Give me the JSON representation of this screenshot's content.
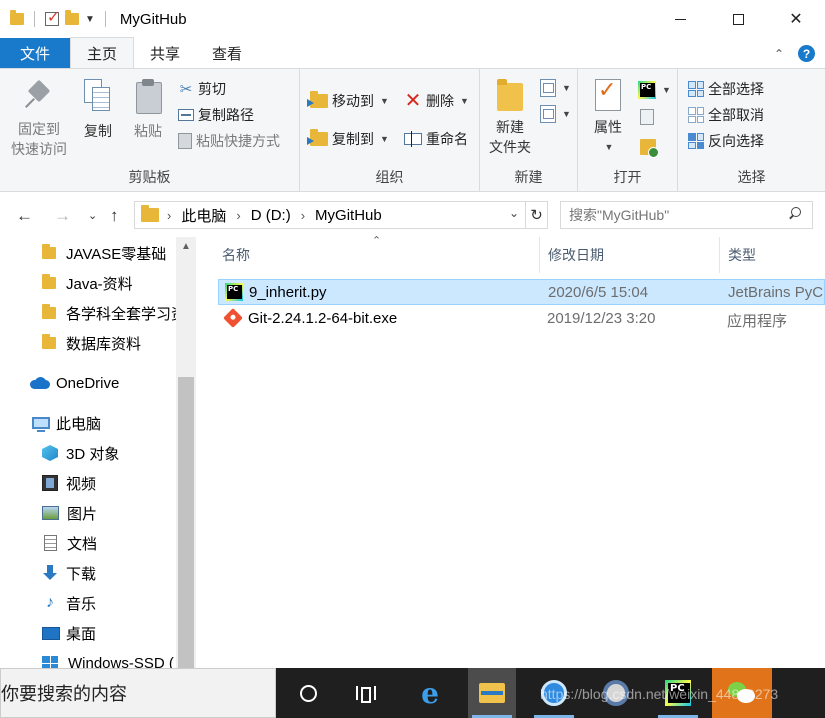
{
  "window": {
    "title": "MyGitHub",
    "controls": {
      "minimize": "—",
      "maximize": "☐",
      "close": "✕"
    }
  },
  "tabs": {
    "file": "文件",
    "items": [
      "主页",
      "共享",
      "查看"
    ],
    "active": "主页"
  },
  "ribbon": {
    "clipboard": {
      "label": "剪贴板",
      "pin": "固定到\n快速访问",
      "pin_line1": "固定到",
      "pin_line2": "快速访问",
      "copy": "复制",
      "paste": "粘贴",
      "cut": "剪切",
      "copy_path": "复制路径",
      "paste_shortcut": "粘贴快捷方式"
    },
    "organize": {
      "label": "组织",
      "move_to": "移动到",
      "copy_to": "复制到",
      "delete": "删除",
      "rename": "重命名"
    },
    "new": {
      "label": "新建",
      "new_folder_line1": "新建",
      "new_folder_line2": "文件夹"
    },
    "open": {
      "label": "打开",
      "properties": "属性"
    },
    "select": {
      "label": "选择",
      "select_all": "全部选择",
      "select_none": "全部取消",
      "invert": "反向选择"
    }
  },
  "address": {
    "crumbs": [
      "此电脑",
      "D (D:)",
      "MyGitHub"
    ],
    "search_placeholder": "搜索\"MyGitHub\""
  },
  "navpane": {
    "folders": [
      "JAVASE零基础",
      "Java-资料",
      "各学科全套学习资",
      "数据库资料"
    ],
    "onedrive": "OneDrive",
    "this_pc": "此电脑",
    "pc_items": [
      "3D 对象",
      "视频",
      "图片",
      "文档",
      "下载",
      "音乐",
      "桌面",
      "Windows-SSD ("
    ]
  },
  "filelist": {
    "columns": {
      "name": "名称",
      "date": "修改日期",
      "type": "类型"
    },
    "rows": [
      {
        "name": "9_inherit.py",
        "date": "2020/6/5 15:04",
        "type": "JetBrains PyC",
        "icon": "pycharm-icon",
        "selected": true
      },
      {
        "name": "Git-2.24.1.2-64-bit.exe",
        "date": "2019/12/23 3:20",
        "type": "应用程序",
        "icon": "git-icon",
        "selected": false
      }
    ]
  },
  "taskbar": {
    "search_text": "你要搜索的内容",
    "watermark": "https://blog.csdn.net/weixin_44829273"
  },
  "colors": {
    "accent": "#1979ca",
    "selection": "#cce8ff",
    "taskbar": "#1f1f1f",
    "orange_tile": "#e1741a"
  }
}
